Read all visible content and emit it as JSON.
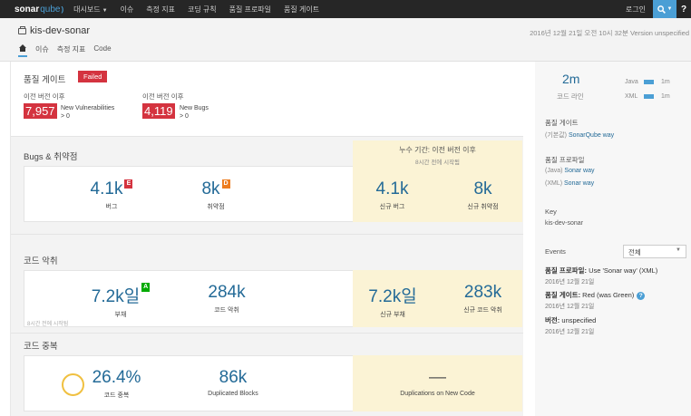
{
  "topnav": {
    "logo_main": "sonar",
    "logo_q": "qube",
    "items": [
      "대시보드",
      "이슈",
      "측정 지표",
      "코딩 규칙",
      "품질 프로파일",
      "품질 게이트"
    ],
    "login": "로그인",
    "help": "?"
  },
  "project": {
    "name": "kis-dev-sonar",
    "meta": "2016년 12월 21일 오전 10시 32분  Version unspecified",
    "tabs": [
      "이슈",
      "측정 지표",
      "Code"
    ]
  },
  "quality_gate": {
    "title": "품질 게이트",
    "status": "Failed",
    "conditions": [
      {
        "period": "이전 버전 이후",
        "value": "7,957",
        "metric": "New Vulnerabilities",
        "threshold": "> 0"
      },
      {
        "period": "이전 버전 이후",
        "value": "4,119",
        "metric": "New Bugs",
        "threshold": "> 0"
      }
    ]
  },
  "leak_period": {
    "title": "누수 기간: 이전 버전 이후",
    "subtitle": "8시간 전에 시작됨"
  },
  "bugs_section": {
    "title": "Bugs & 취약점",
    "bugs": {
      "value": "4.1k",
      "rating": "E",
      "label": "버그"
    },
    "vulns": {
      "value": "8k",
      "rating": "D",
      "label": "취약점"
    },
    "new_bugs": {
      "value": "4.1k",
      "label": "신규 버그"
    },
    "new_vulns": {
      "value": "8k",
      "label": "신규 취약점"
    }
  },
  "smells_section": {
    "title": "코드 악취",
    "debt": {
      "value": "7.2k일",
      "rating": "A",
      "label": "부채"
    },
    "smells": {
      "value": "284k",
      "label": "코드 악취"
    },
    "new_debt": {
      "value": "7.2k일",
      "label": "신규 부채"
    },
    "new_smells": {
      "value": "283k",
      "label": "신규 코드 악취"
    },
    "note": "8시간 전에 시작됨"
  },
  "dup_section": {
    "title": "코드 중복",
    "density": {
      "value": "26.4%",
      "label": "코드 중복"
    },
    "blocks": {
      "value": "86k",
      "label": "Duplicated Blocks"
    },
    "new_dup": {
      "value": "—",
      "label": "Duplications on New Code"
    }
  },
  "sidebar": {
    "loc_value": "2m",
    "loc_label": "코드 라인",
    "languages": [
      {
        "name": "Java",
        "value": "1m"
      },
      {
        "name": "XML",
        "value": "1m"
      }
    ],
    "qg_label": "품질 게이트",
    "qg_default": "(기본값)",
    "qg_link": "SonarQube way",
    "qp_label": "품질 프로파일",
    "qp_java_lang": "(Java)",
    "qp_java_link": "Sonar way",
    "qp_xml_lang": "(XML)",
    "qp_xml_link": "Sonar way",
    "key_label": "Key",
    "key_value": "kis-dev-sonar",
    "events_label": "Events",
    "events_filter": "전체",
    "events": [
      {
        "title_bold": "품질 프로파일:",
        "title": " Use 'Sonar way' (XML)",
        "date": "2016년 12월 21일"
      },
      {
        "title_bold": "품질 게이트:",
        "title": " Red (was Green)",
        "date": "2016년 12월 21일"
      },
      {
        "title_bold": "버전:",
        "title": " unspecified",
        "date": "2016년 12월 21일"
      }
    ]
  },
  "colors": {
    "accent": "#4b9fd5",
    "link": "#236a97",
    "error": "#d4333f",
    "rating_d": "#ed7d20",
    "rating_a": "#00aa00",
    "leak_bg": "#fbf3d5",
    "nav_bg": "#262626"
  }
}
